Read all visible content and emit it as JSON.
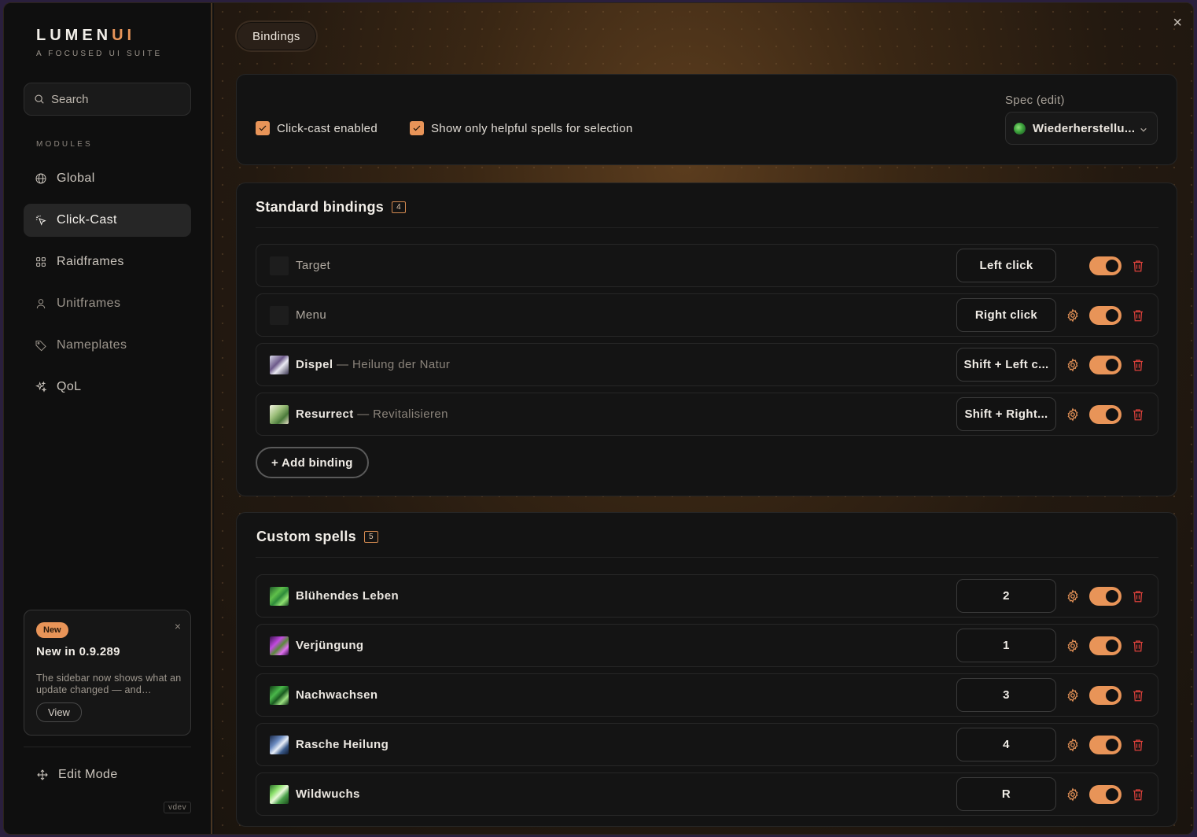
{
  "brand": {
    "name_main": "LUMEN",
    "name_accent": "UI",
    "tagline": "A FOCUSED UI SUITE"
  },
  "search": {
    "placeholder": "Search"
  },
  "sidebar": {
    "section_label": "MODULES",
    "items": [
      {
        "label": "Global",
        "icon": "globe-icon",
        "active": false
      },
      {
        "label": "Click-Cast",
        "icon": "cursor-click-icon",
        "active": true
      },
      {
        "label": "Raidframes",
        "icon": "grid-icon",
        "active": false
      },
      {
        "label": "Unitframes",
        "icon": "user-icon",
        "active": false
      },
      {
        "label": "Nameplates",
        "icon": "tag-icon",
        "active": false
      },
      {
        "label": "QoL",
        "icon": "sparkles-icon",
        "active": false
      }
    ],
    "news": {
      "badge": "New",
      "title": "New in 0.9.289",
      "body": "The sidebar now shows what an update changed — and…",
      "view_label": "View",
      "close": "×"
    },
    "edit_mode_label": "Edit Mode",
    "version": "vdev"
  },
  "main": {
    "tab_label": "Bindings",
    "close": "×",
    "options": {
      "click_cast_label": "Click-cast enabled",
      "click_cast_checked": true,
      "helpful_only_label": "Show only helpful spells for selection",
      "helpful_only_checked": true,
      "spec_label": "Spec (edit)",
      "spec_value": "Wiederherstellu..."
    },
    "standard": {
      "title": "Standard bindings",
      "count": "4",
      "rows": [
        {
          "name": "Target",
          "sub": "",
          "binding": "Left click",
          "has_gear": false,
          "enabled": true,
          "icon": "blank"
        },
        {
          "name": "Menu",
          "sub": "",
          "binding": "Right click",
          "has_gear": true,
          "enabled": true,
          "icon": "blank"
        },
        {
          "name": "Dispel",
          "sub": "— Heilung der Natur",
          "binding": "Shift + Left c...",
          "has_gear": true,
          "enabled": true,
          "icon": "dispel"
        },
        {
          "name": "Resurrect",
          "sub": "— Revitalisieren",
          "binding": "Shift + Right...",
          "has_gear": true,
          "enabled": true,
          "icon": "resurrect"
        }
      ],
      "add_label": "+ Add binding"
    },
    "custom": {
      "title": "Custom spells",
      "count": "5",
      "rows": [
        {
          "name": "Blühendes Leben",
          "binding": "2",
          "enabled": true,
          "icon": "lifebloom"
        },
        {
          "name": "Verjüngung",
          "binding": "1",
          "enabled": true,
          "icon": "rejuv"
        },
        {
          "name": "Nachwachsen",
          "binding": "3",
          "enabled": true,
          "icon": "regrowth"
        },
        {
          "name": "Rasche Heilung",
          "binding": "4",
          "enabled": true,
          "icon": "swiftmend"
        },
        {
          "name": "Wildwuchs",
          "binding": "R",
          "enabled": true,
          "icon": "wildgrowth"
        }
      ]
    }
  },
  "colors": {
    "accent": "#e89458",
    "danger": "#d9403a"
  }
}
